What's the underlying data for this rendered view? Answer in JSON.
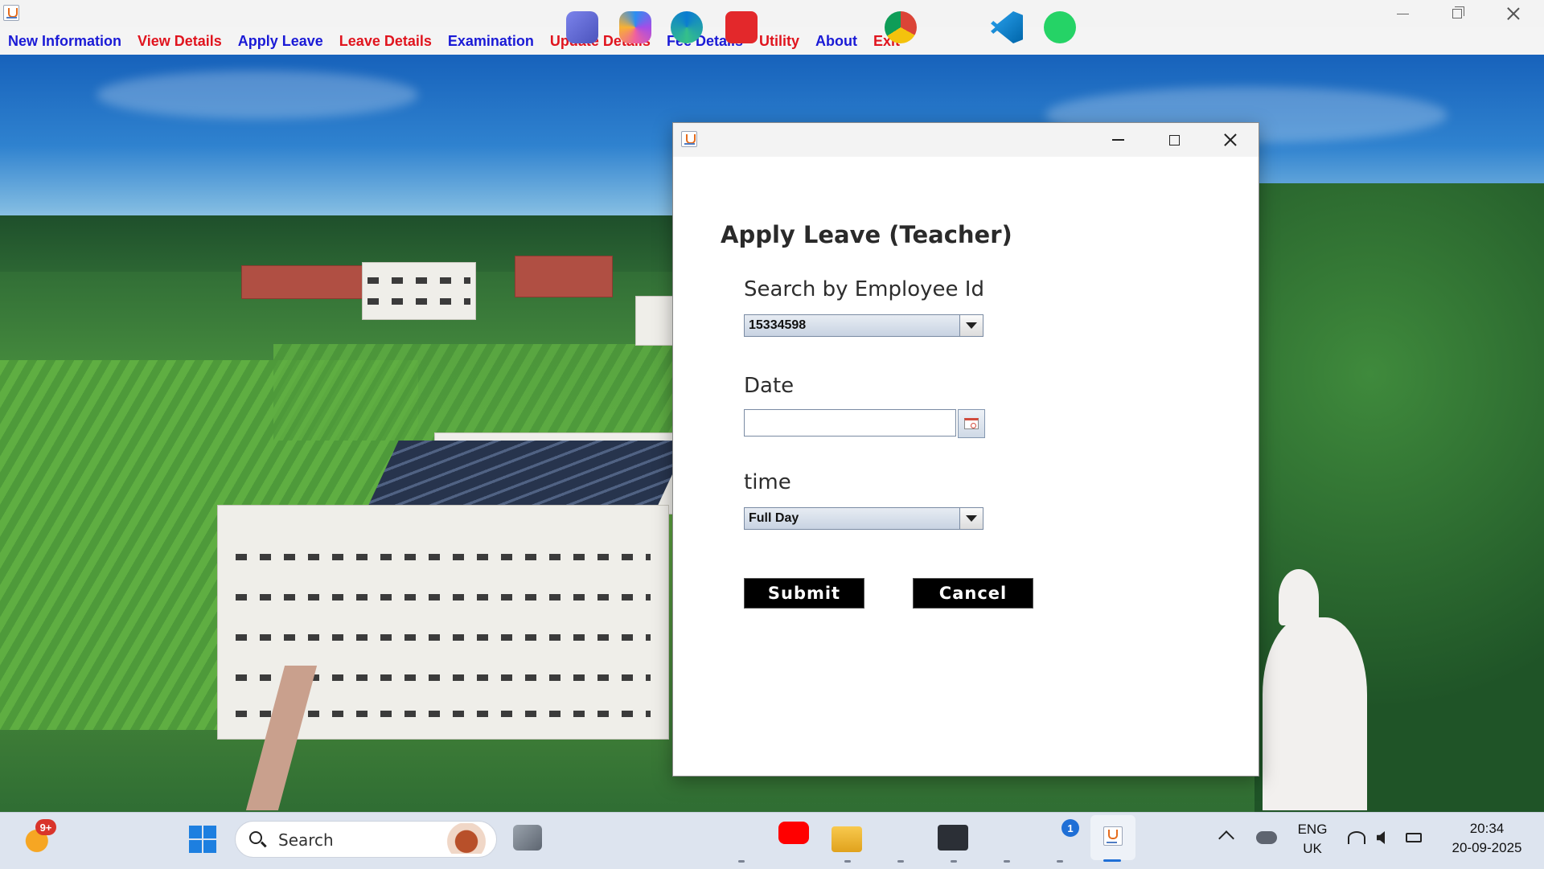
{
  "main_window": {
    "menu": [
      {
        "label": "New Information",
        "color": "#1a1ad6"
      },
      {
        "label": "View Details",
        "color": "#e0141e"
      },
      {
        "label": "Apply Leave",
        "color": "#1a1ad6"
      },
      {
        "label": "Leave Details",
        "color": "#e0141e"
      },
      {
        "label": "Examination",
        "color": "#1a1ad6"
      },
      {
        "label": "Update Details",
        "color": "#e0141e"
      },
      {
        "label": "Fee Details",
        "color": "#1a1ad6"
      },
      {
        "label": "Utility",
        "color": "#e0141e"
      },
      {
        "label": "About",
        "color": "#1a1ad6"
      },
      {
        "label": "Exit",
        "color": "#e0141e"
      }
    ]
  },
  "dialog": {
    "title": "Apply Leave (Teacher)",
    "employee_label": "Search by Employee Id",
    "employee_value": "15334598",
    "date_label": "Date",
    "date_value": "",
    "time_label": "time",
    "time_value": "Full Day",
    "submit_label": "Submit",
    "cancel_label": "Cancel"
  },
  "taskbar": {
    "search_placeholder": "Search",
    "weather_badge": "9+",
    "whatsapp_badge": "1",
    "language_line1": "ENG",
    "language_line2": "UK",
    "time": "20:34",
    "date": "20-09-2025",
    "icons": [
      "widgets-icon",
      "start-icon",
      "search-icon",
      "task-view-icon",
      "teams-icon",
      "copilot-icon",
      "edge-icon",
      "wps-office-icon",
      "youtube-icon",
      "file-explorer-icon",
      "chrome-icon",
      "terminal-icon",
      "vscode-icon",
      "whatsapp-icon",
      "java-icon"
    ]
  },
  "colors": {
    "menu_blue": "#1a1ad6",
    "menu_red": "#e0141e",
    "button_bg": "#000000",
    "button_text": "#ffffff"
  }
}
